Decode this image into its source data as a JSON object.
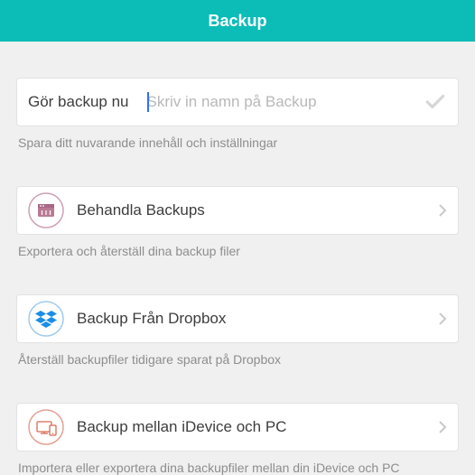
{
  "header": {
    "title": "Backup"
  },
  "backupNow": {
    "label": "Gör backup nu",
    "placeholder": "Skriv in namn på Backup",
    "value": "",
    "hint": "Spara ditt nuvarande innehåll och inställningar"
  },
  "rows": {
    "manage": {
      "title": "Behandla Backups",
      "hint": "Exportera och återställ dina backup filer"
    },
    "dropbox": {
      "title": "Backup Från Dropbox",
      "hint": "Återställ backupfiler tidigare sparat på Dropbox"
    },
    "idevice": {
      "title": "Backup mellan iDevice och PC",
      "hint": "Importera eller exportera dina backupfiler mellan din iDevice och PC"
    }
  }
}
